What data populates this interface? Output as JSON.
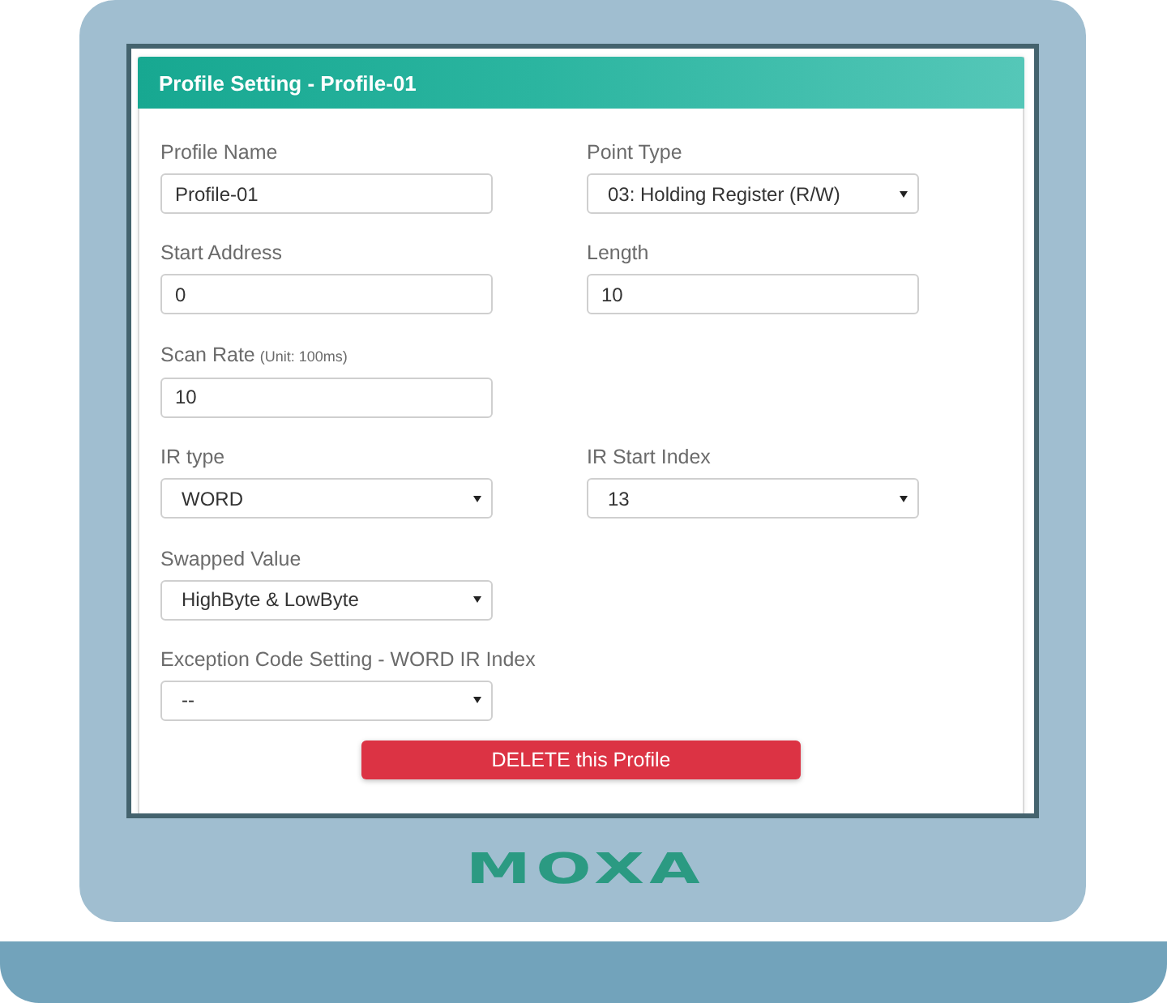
{
  "panel": {
    "title": "Profile Setting - Profile-01",
    "rows": [
      [
        {
          "kind": "text",
          "label": "Profile Name",
          "value": "Profile-01"
        },
        {
          "kind": "select",
          "label": "Point Type",
          "value": "03: Holding Register (R/W)"
        }
      ],
      [
        {
          "kind": "text",
          "label": "Start Address",
          "value": "0"
        },
        {
          "kind": "text",
          "label": "Length",
          "value": "10"
        }
      ],
      [
        {
          "kind": "text",
          "label": "Scan Rate",
          "unit": "(Unit: 100ms)",
          "value": "10"
        }
      ],
      [
        {
          "kind": "select",
          "label": "IR type",
          "value": "WORD"
        },
        {
          "kind": "select",
          "label": "IR Start Index",
          "value": "13"
        }
      ],
      [
        {
          "kind": "select",
          "label": "Swapped Value",
          "value": "HighByte & LowByte"
        }
      ],
      [
        {
          "kind": "select",
          "label": "Exception Code Setting - WORD IR Index",
          "value": "--"
        }
      ]
    ],
    "delete_button": "DELETE this Profile"
  },
  "device": {
    "logo": "MOXA"
  }
}
